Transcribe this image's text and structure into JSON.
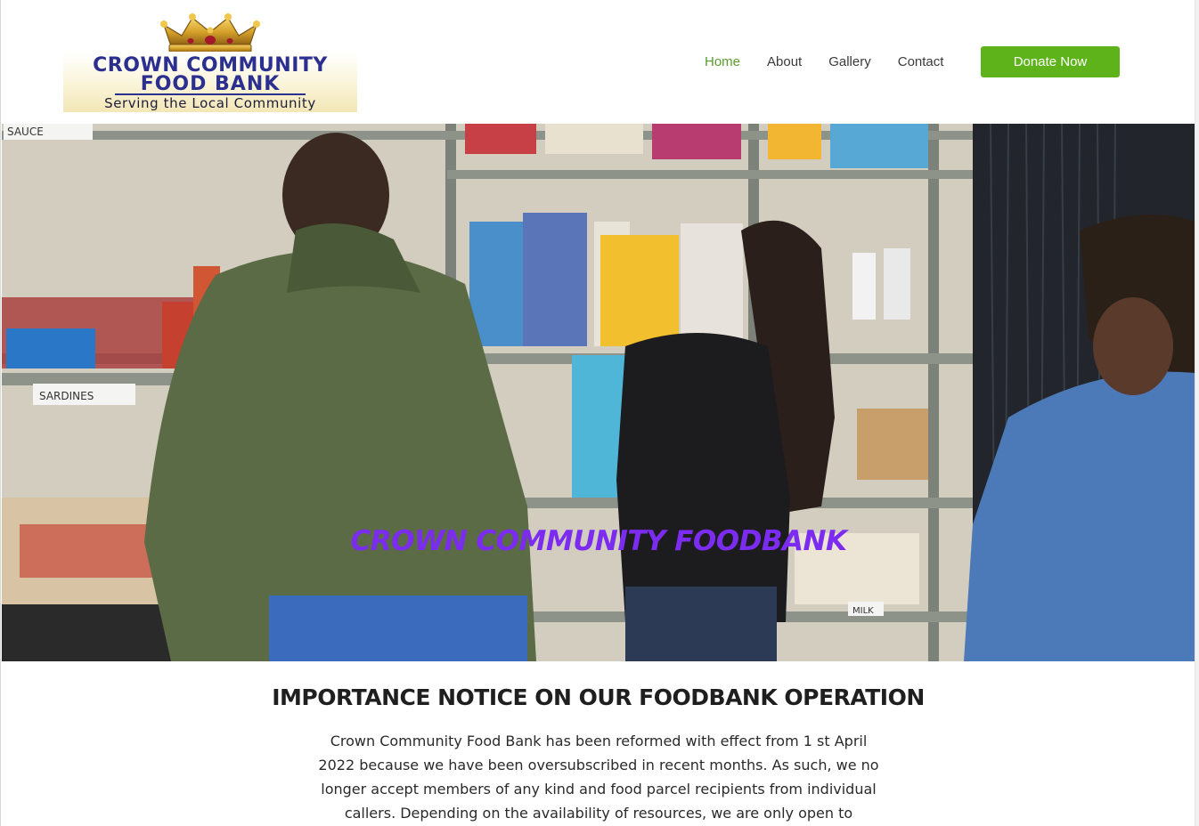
{
  "logo": {
    "line1": "CROWN COMMUNITY",
    "line2": "FOOD BANK",
    "tagline": "Serving the Local Community",
    "crown_icon": "crown-icon"
  },
  "nav": {
    "items": [
      {
        "label": "Home",
        "active": true
      },
      {
        "label": "About",
        "active": false
      },
      {
        "label": "Gallery",
        "active": false
      },
      {
        "label": "Contact",
        "active": false
      }
    ],
    "donate_label": "Donate Now"
  },
  "hero": {
    "title": "CROWN COMMUNITY  FOODBANK",
    "shelf_labels": [
      "SAUCE",
      "SARDINES",
      "MILK"
    ]
  },
  "notice": {
    "heading": "IMPORTANCE NOTICE ON OUR FOODBANK OPERATION",
    "lines": [
      "Crown Community Food Bank has been reformed with effect from 1 st April",
      "2022 because we have been oversubscribed in recent months. As such, we no",
      "longer accept members of any kind and food parcel recipients from individual",
      "callers. Depending on the availability of resources, we are only open to"
    ]
  },
  "colors": {
    "accent": "#5fb31a",
    "nav_active": "#5a9b2e",
    "hero_title": "#7b2cf0",
    "logo_text": "#2b2f8f"
  }
}
